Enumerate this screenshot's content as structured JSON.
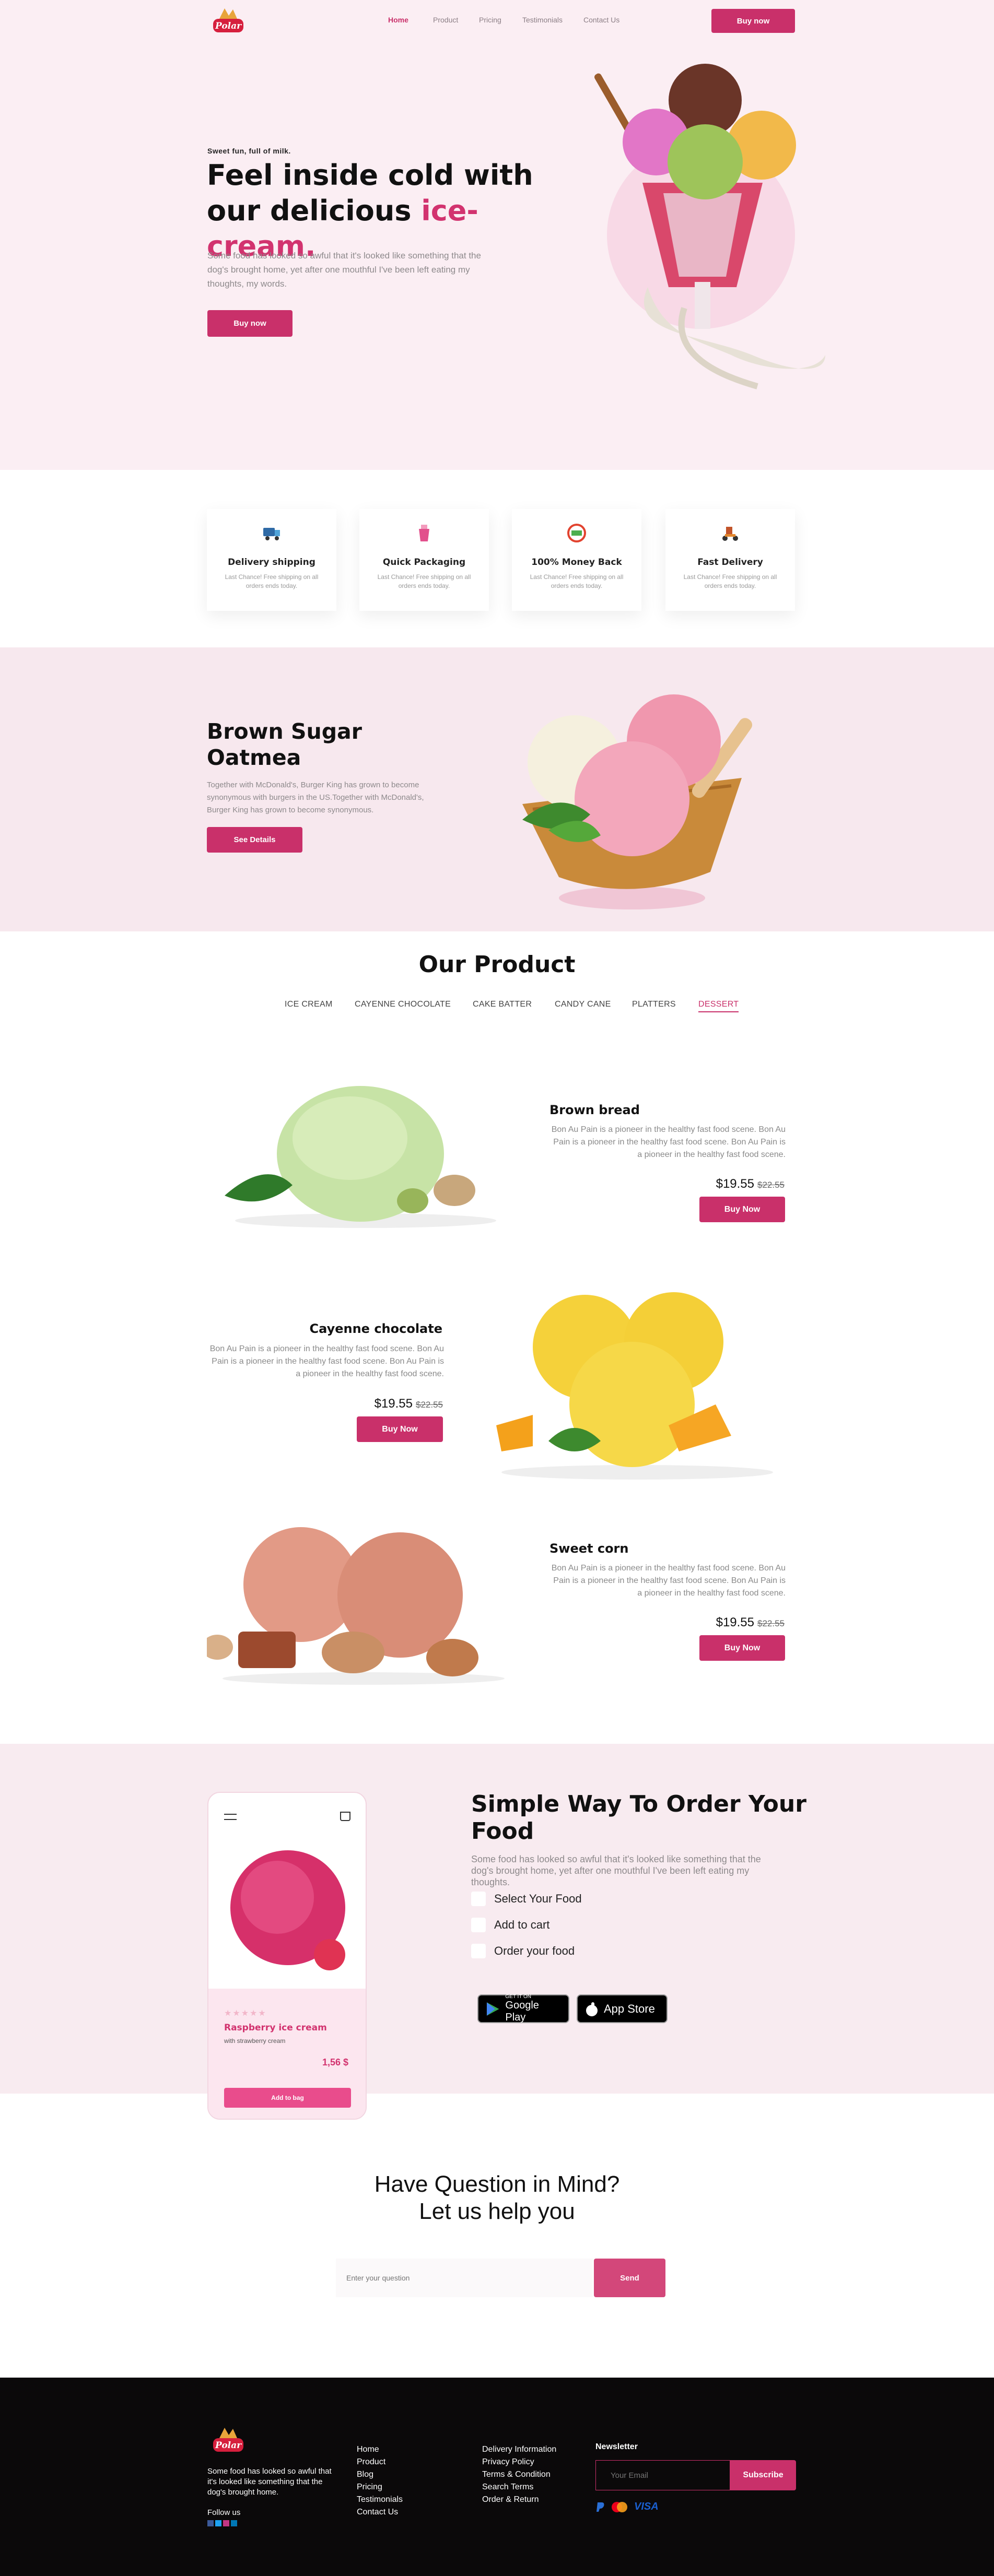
{
  "header": {
    "logo_text": "Polar",
    "nav": [
      "Home",
      "Product",
      "Pricing",
      "Testimonials",
      "Contact Us"
    ],
    "buy_label": "Buy now"
  },
  "hero": {
    "tagline": "Sweet fun, full of milk.",
    "title_line1": "Feel inside cold with",
    "title_line2": "our delicious ",
    "title_highlight": "ice-cream.",
    "description": "Some food has looked so awful that it's looked like something that the dog's brought home, yet after one mouthful I've been left eating my thoughts, my words.",
    "button": "Buy now"
  },
  "features": [
    {
      "icon": "truck-icon",
      "title": "Delivery shipping",
      "desc": "Last Chance! Free shipping on all orders ends today."
    },
    {
      "icon": "cup-icon",
      "title": "Quick Packaging",
      "desc": "Last Chance! Free shipping on all orders ends today."
    },
    {
      "icon": "money-icon",
      "title": "100% Money Back",
      "desc": "Last Chance! Free shipping on all orders ends today."
    },
    {
      "icon": "scooter-icon",
      "title": "Fast Delivery",
      "desc": "Last Chance! Free shipping on all orders ends today."
    }
  ],
  "band": {
    "title_line1": "Brown Sugar",
    "title_line2": "Oatmea",
    "description": "Together with McDonald's, Burger King has grown to become synonymous with burgers in the US.Together with McDonald's, Burger King has grown to become synonymous.",
    "button": "See Details"
  },
  "products": {
    "heading": "Our Product",
    "tabs": [
      "ICE CREAM",
      "CAYENNE CHOCOLATE",
      "CAKE BATTER",
      "CANDY CANE",
      "PLATTERS",
      "DESSERT"
    ],
    "selected_tab": "DESSERT",
    "items": [
      {
        "name": "Brown bread",
        "desc": "Bon Au Pain is a pioneer in the healthy fast food scene. Bon Au Pain is a pioneer in the healthy fast food scene. Bon Au Pain is a pioneer in the healthy fast food scene.",
        "price": "$19.55",
        "old_price": "$22.55",
        "button": "Buy Now"
      },
      {
        "name": "Cayenne chocolate",
        "desc": "Bon Au Pain is a pioneer in the healthy fast food scene. Bon Au Pain is a pioneer in the healthy fast food scene. Bon Au Pain is a pioneer in the healthy fast food scene.",
        "price": "$19.55",
        "old_price": "$22.55",
        "button": "Buy Now"
      },
      {
        "name": "Sweet corn",
        "desc": "Bon Au Pain is a pioneer in the healthy fast food scene. Bon Au Pain is a pioneer in the healthy fast food scene. Bon Au Pain is a pioneer in the healthy fast food scene.",
        "price": "$19.55",
        "old_price": "$22.55",
        "button": "Buy Now"
      }
    ]
  },
  "order": {
    "title_line1": "Simple Way To Order Your",
    "title_line2": "Food",
    "description": "Some food has looked so awful that it's looked like something that the dog's brought home, yet after one mouthful I've been left eating my thoughts.",
    "steps": [
      "Select Your Food",
      "Add to cart",
      "Order your food"
    ],
    "phone": {
      "name": "Raspberry ice cream",
      "sub": "with strawberry cream",
      "price": "1,56 $",
      "button": "Add to bag"
    },
    "google_small": "GET IT ON",
    "google_big": "Google Play",
    "apple_big": "App Store"
  },
  "question": {
    "title_line1": "Have Question in Mind?",
    "title_line2": "Let us help you",
    "placeholder": "Enter your question",
    "button": "Send"
  },
  "footer": {
    "logo_text": "Polar",
    "about": "Some food has looked so awful that it's looked like something that the dog's brought home.",
    "follow": "Follow us",
    "col1": [
      "Home",
      "Product",
      "Blog",
      "Pricing",
      "Testimonials",
      "Contact Us"
    ],
    "col2": [
      "Delivery Information",
      "Privacy Policy",
      "Terms & Condition",
      "Search Terms",
      "Order & Return"
    ],
    "newsletter": "Newsletter",
    "email_placeholder": "Your Email",
    "subscribe": "Subscribe",
    "visa": "VISA"
  },
  "colors": {
    "accent": "#c9306a",
    "hero_bg": "#fbeef3",
    "footer_bg": "#0b090a"
  }
}
